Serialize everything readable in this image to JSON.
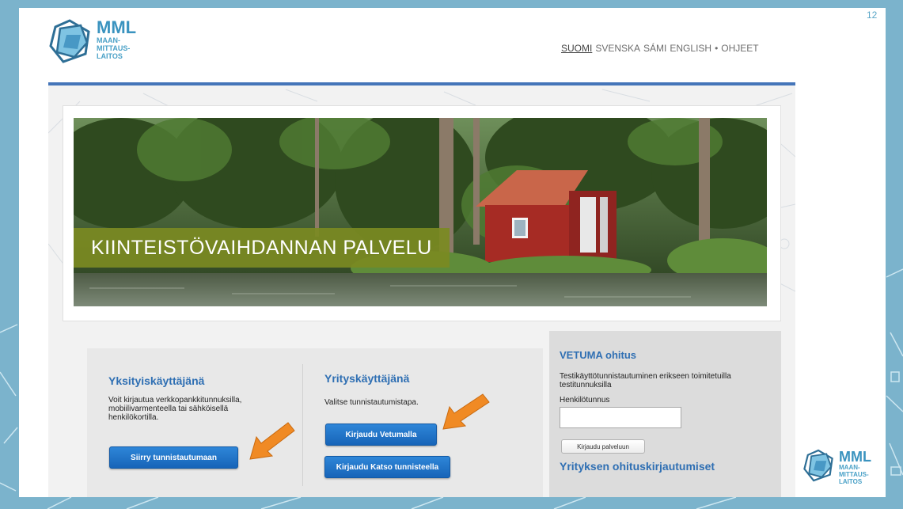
{
  "slide_number": "12",
  "logo": {
    "main": "MML",
    "line1": "MAAN-",
    "line2": "MITTAUS-",
    "line3": "LAITOS"
  },
  "languages": [
    {
      "label": "SUOMI",
      "active": true
    },
    {
      "label": "SVENSKA",
      "active": false
    },
    {
      "label": "SÁMI",
      "active": false
    },
    {
      "label": "ENGLISH",
      "active": false
    }
  ],
  "lang_separator": "•",
  "help_link": "OHJEET",
  "hero_title": "KIINTEISTÖVAIHDANNAN PALVELU",
  "private_user": {
    "title": "Yksityiskäyttäjänä",
    "text": "Voit kirjautua verkkopankkitunnuksilla, mobiilivarmenteella tai sähköisellä henkilökortilla.",
    "button": "Siirry tunnistautumaan"
  },
  "business_user": {
    "title": "Yrityskäyttäjänä",
    "text": "Valitse tunnistautumistapa.",
    "button_vetuma": "Kirjaudu Vetumalla",
    "button_katso": "Kirjaudu Katso tunnisteella"
  },
  "vetuma": {
    "title": "VETUMA ohitus",
    "text": "Testikäyttötunnistautuminen erikseen toimitetuilla testitunnuksilla",
    "field_label": "Henkilötunnus",
    "field_value": "",
    "button": "Kirjaudu palveluun",
    "subtitle": "Yrityksen ohituskirjautumiset"
  },
  "colors": {
    "frame": "#7bb3cc",
    "brand_blue": "#2f6fb3",
    "header_rule": "#4575b9",
    "hero_banner": "#7b8a22",
    "button": "#1e74c9",
    "arrow": "#f08a24"
  }
}
